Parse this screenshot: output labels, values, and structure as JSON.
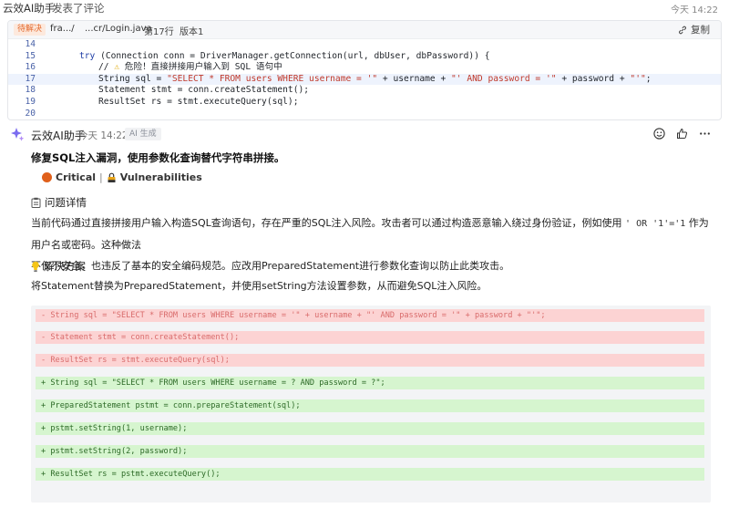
{
  "topbar": {
    "author": "云效AI助手",
    "action": "发表了评论",
    "time": "今天 14:22"
  },
  "file": {
    "status": "待解决",
    "path_prefix": "fra.../",
    "path_suffix": "...cr/Login.java",
    "line": "第17行",
    "version": "版本1",
    "copy_label": "复制"
  },
  "code_lines": [
    {
      "n": "14",
      "highlight": false
    },
    {
      "n": "15",
      "highlight": false
    },
    {
      "n": "16",
      "highlight": false
    },
    {
      "n": "17",
      "highlight": true
    },
    {
      "n": "18",
      "highlight": false
    },
    {
      "n": "19",
      "highlight": false
    },
    {
      "n": "20",
      "highlight": false
    }
  ],
  "code": {
    "l15_kw": "try",
    "l15_rest": " (Connection conn = DriverManager.getConnection(url, dbUser, dbPassword)) {",
    "l16_prefix": "// ",
    "l16_comment": " 危险！直接拼接用户输入到 SQL 语句中",
    "l17_a": "String sql = ",
    "l17_str1": "\"SELECT * FROM users WHERE username = '\"",
    "l17_b": " + username + ",
    "l17_str2": "\"' AND password = '\"",
    "l17_c": " + password + ",
    "l17_str3": "\"'\"",
    "l17_d": ";",
    "l18": "Statement stmt = conn.createStatement();",
    "l19": "ResultSet rs = stmt.executeQuery(sql);"
  },
  "ai": {
    "name": "云效AI助手",
    "time": "今天 14:22",
    "gen_label": "AI 生成"
  },
  "comment": {
    "title": "修复SQL注入漏洞，使用参数化查询替代字符串拼接。",
    "severity": "Critical",
    "category": "Vulnerabilities",
    "details_heading": "问题详情",
    "details_p1": "当前代码通过直接拼接用户输入构造SQL查询语句，存在严重的SQL注入风险。攻击者可以通过构造恶意输入绕过身份验证，例如使用",
    "details_code": "' OR '1'='1",
    "details_p2": "作为用户名或密码。这种做法",
    "details_line2": "不仅不安全，也违反了基本的安全编码规范。应改用PreparedStatement进行参数化查询以防止此类攻击。",
    "solution_heading": "解决方案",
    "solution_text": "将Statement替换为PreparedStatement，并使用setString方法设置参数，从而避免SQL注入风险。"
  },
  "diff": [
    {
      "type": "del",
      "text": "- String sql = \"SELECT * FROM users WHERE username = '\" + username + \"' AND password = '\" + password + \"'\";"
    },
    {
      "type": "del",
      "text": "- Statement stmt = conn.createStatement();"
    },
    {
      "type": "del",
      "text": "- ResultSet rs = stmt.executeQuery(sql);"
    },
    {
      "type": "add",
      "text": "+ String sql = \"SELECT * FROM users WHERE username = ? AND password = ?\";"
    },
    {
      "type": "add",
      "text": "+ PreparedStatement pstmt = conn.prepareStatement(sql);"
    },
    {
      "type": "add",
      "text": "+ pstmt.setString(1, username);"
    },
    {
      "type": "add",
      "text": "+ pstmt.setString(2, password);"
    },
    {
      "type": "add",
      "text": "+ ResultSet rs = pstmt.executeQuery();"
    }
  ],
  "colors": {
    "delete_bg": "#fcd3d3",
    "add_bg": "#d6f5cf",
    "critical": "#e0601b",
    "accent": "#1f3ea6"
  },
  "icons": {
    "copy": "copy-icon",
    "emoji": "emoji-icon",
    "like": "thumbs-up-icon",
    "more": "more-icon",
    "warning": "warning-icon",
    "clipboard": "clipboard-icon",
    "bulb": "lightbulb-icon",
    "lock": "lock-icon"
  }
}
